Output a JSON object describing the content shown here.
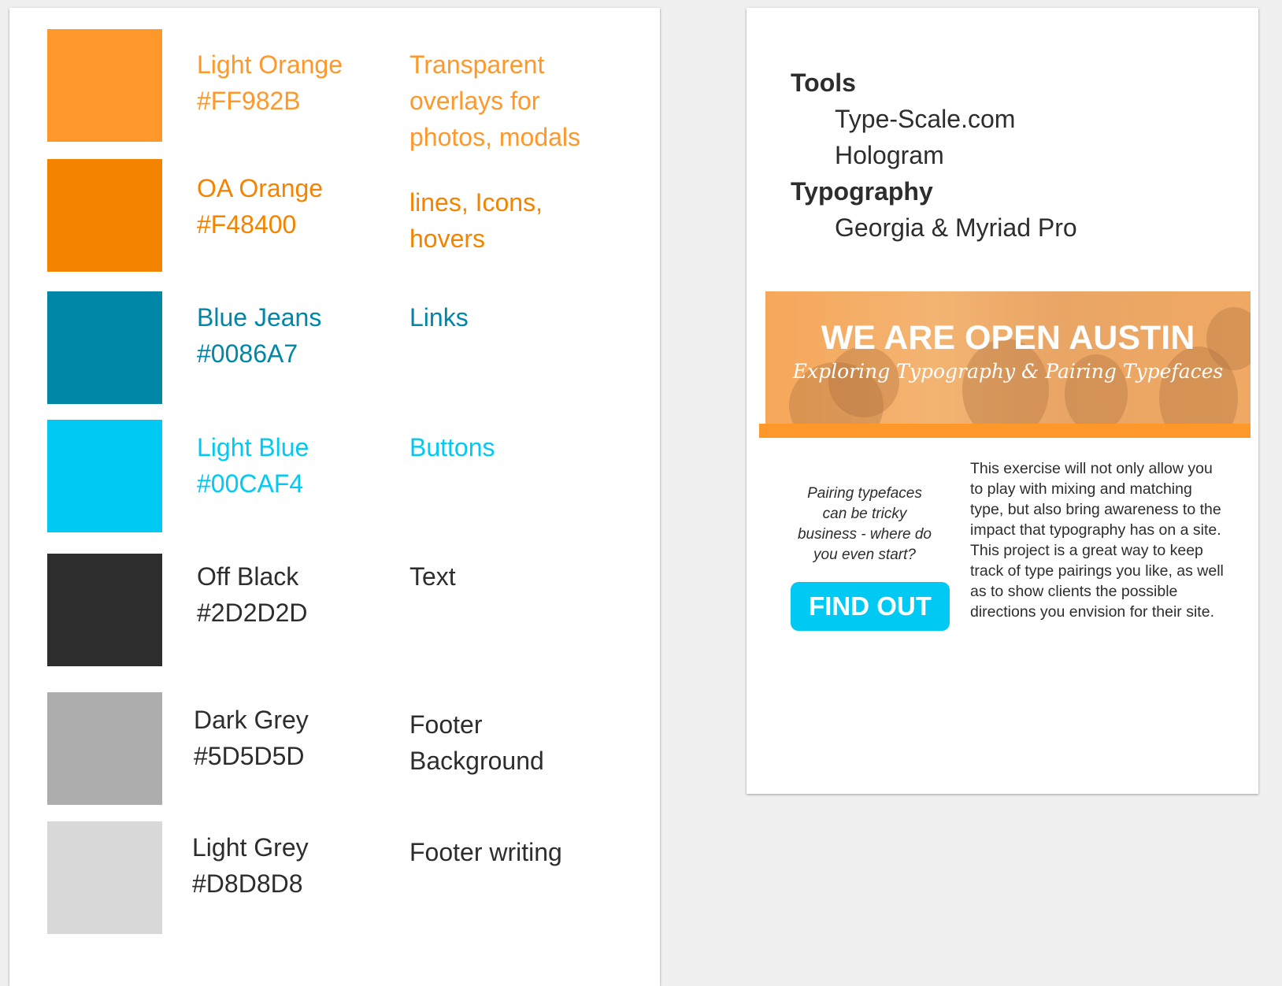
{
  "palette": [
    {
      "swatch_color": "#FF982B",
      "text_color": "#FF982B",
      "name": "Light Orange\n#FF982B",
      "use": "Transparent\noverlays for\nphotos, modals"
    },
    {
      "swatch_color": "#F48400",
      "text_color": "#F48400",
      "name": "OA Orange\n#F48400",
      "use": "lines, Icons,\nhovers"
    },
    {
      "swatch_color": "#0086A7",
      "text_color": "#0086A7",
      "name": "Blue Jeans\n#0086A7",
      "use": "Links"
    },
    {
      "swatch_color": "#00CAF4",
      "text_color": "#00CAF4",
      "name": "Light Blue\n#00CAF4",
      "use": "Buttons"
    },
    {
      "swatch_color": "#2D2D2D",
      "text_color": "#2D2D2D",
      "name": "Off Black\n#2D2D2D",
      "use": "Text"
    },
    {
      "swatch_color": "#ADADAD",
      "text_color": "#2D2D2D",
      "name": "Dark Grey\n#5D5D5D",
      "use": "Footer\nBackground"
    },
    {
      "swatch_color": "#D8D8D8",
      "text_color": "#2D2D2D",
      "name": "Light Grey\n#D8D8D8",
      "use": "Footer writing"
    }
  ],
  "tools": {
    "heading": "Tools",
    "items": [
      "Type-Scale.com",
      "Hologram"
    ]
  },
  "typography": {
    "heading": "Typography",
    "items": [
      "Georgia & Myriad Pro"
    ]
  },
  "hero": {
    "title": "WE ARE OPEN AUSTIN",
    "subtitle": "Exploring Typography & Pairing Typefaces"
  },
  "cta": {
    "question": "Pairing typefaces can be tricky business - where do you even start?",
    "button_label": "FIND OUT",
    "description": "This exercise will not only allow you to play with mixing and matching type, but also bring awareness to the impact that typography has on a site. This project is a great way to keep track of type pairings you like, as well as to show clients the possible directions you envision for their site."
  }
}
